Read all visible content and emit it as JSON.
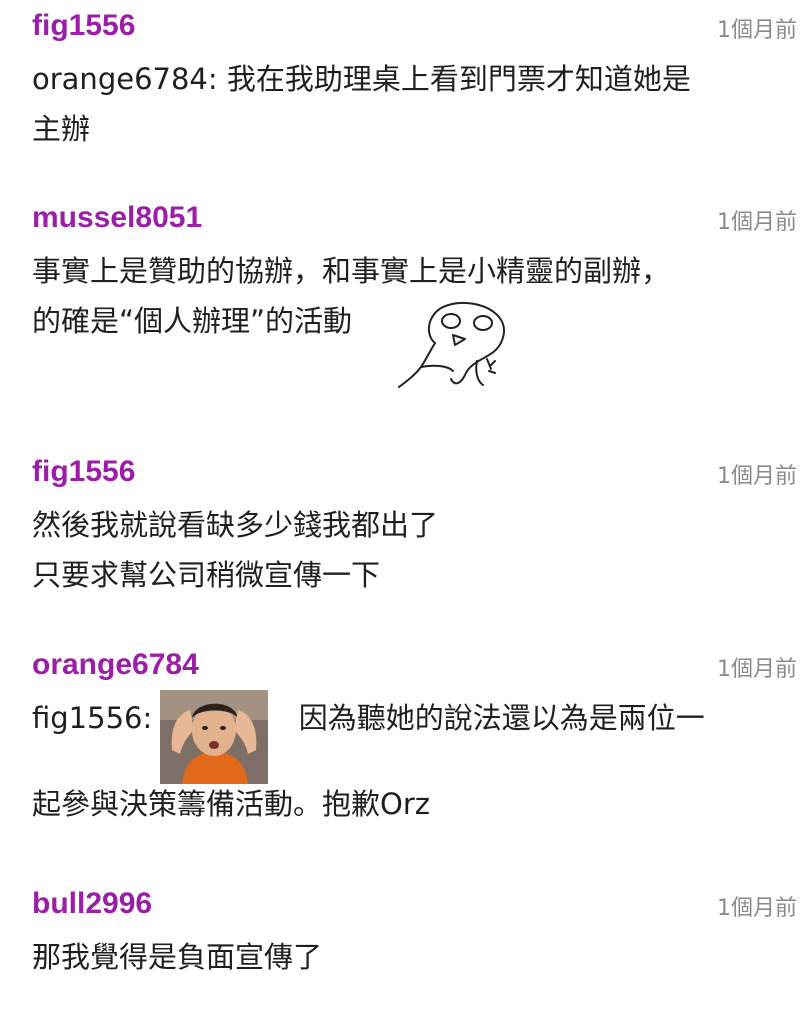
{
  "comments": [
    {
      "username": "fig1556",
      "time": "1個月前",
      "lines": [
        "orange6784: 我在我助理桌上看到門票才知道她是",
        "主辦"
      ]
    },
    {
      "username": "mussel8051",
      "time": "1個月前",
      "lines": [
        "事實上是贊助的協辦，和事實上是小精靈的副辦，",
        "的確是“個人辦理”的活動"
      ]
    },
    {
      "username": "fig1556",
      "time": "1個月前",
      "lines": [
        "然後我就說看缺多少錢我都出了",
        "只要求幫公司稍微宣傳一下"
      ]
    },
    {
      "username": "orange6784",
      "time": "1個月前",
      "mention": "fig1556:",
      "line1_after_sticker": "因為聽她的說法還以為是兩位一",
      "line2": "起參與決策籌備活動。抱歉Orz"
    },
    {
      "username": "bull2996",
      "time": "1個月前",
      "lines": [
        "那我覺得是負面宣傳了"
      ]
    }
  ],
  "colors": {
    "username": "#9b1fa6",
    "timestamp": "#8a8a8a",
    "text": "#1f1f1f"
  }
}
